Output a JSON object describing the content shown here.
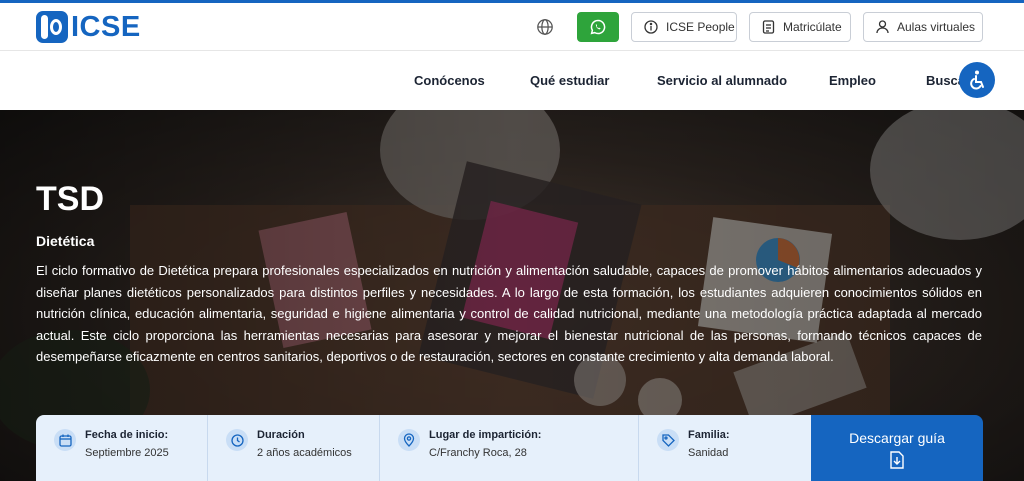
{
  "brand": {
    "name": "ICSE",
    "color": "#1565c0"
  },
  "topbar": {
    "language_icon": "globe-icon",
    "whatsapp_icon": "whatsapp-icon",
    "buttons": [
      {
        "label": "ICSE People",
        "icon": "info-circle-icon"
      },
      {
        "label": "Matricúlate",
        "icon": "form-icon"
      },
      {
        "label": "Aulas virtuales",
        "icon": "user-icon"
      }
    ]
  },
  "nav": {
    "items": [
      "Conócenos",
      "Qué estudiar",
      "Servicio al alumnado",
      "Empleo",
      "Busca"
    ],
    "accessibility_icon": "accessibility-icon"
  },
  "hero": {
    "title": "TSD",
    "subtitle": "Dietética",
    "description": "El ciclo formativo de Dietética prepara profesionales especializados en nutrición y alimentación saludable, capaces de promover hábitos alimentarios adecuados y diseñar planes dietéticos personalizados para distintos perfiles y necesidades. A lo largo de esta formación, los estudiantes adquieren conocimientos sólidos en nutrición clínica, educación alimentaria, seguridad e higiene alimentaria y control de calidad nutricional, mediante una metodología práctica adaptada al mercado actual. Este ciclo proporciona las herramientas necesarias para asesorar y mejorar el bienestar nutricional de las personas, formando técnicos capaces de desempeñarse eficazmente en centros sanitarios, deportivos o de restauración, sectores en constante crecimiento y alta demanda laboral."
  },
  "info": {
    "start": {
      "label": "Fecha de inicio:",
      "value": "Septiembre 2025",
      "icon": "calendar-icon"
    },
    "duration": {
      "label": "Duración",
      "value": "2 años académicos",
      "icon": "clock-icon"
    },
    "location": {
      "label": "Lugar de impartición:",
      "value": "C/Franchy Roca, 28",
      "icon": "location-pin-icon"
    },
    "family": {
      "label": "Familia:",
      "value": "Sanidad",
      "icon": "tag-icon"
    }
  },
  "download": {
    "label": "Descargar guía",
    "icon": "download-file-icon"
  },
  "colors": {
    "accent": "#1565c0",
    "whatsapp": "#2ea43b",
    "info_bar": "#e6f0fb"
  }
}
